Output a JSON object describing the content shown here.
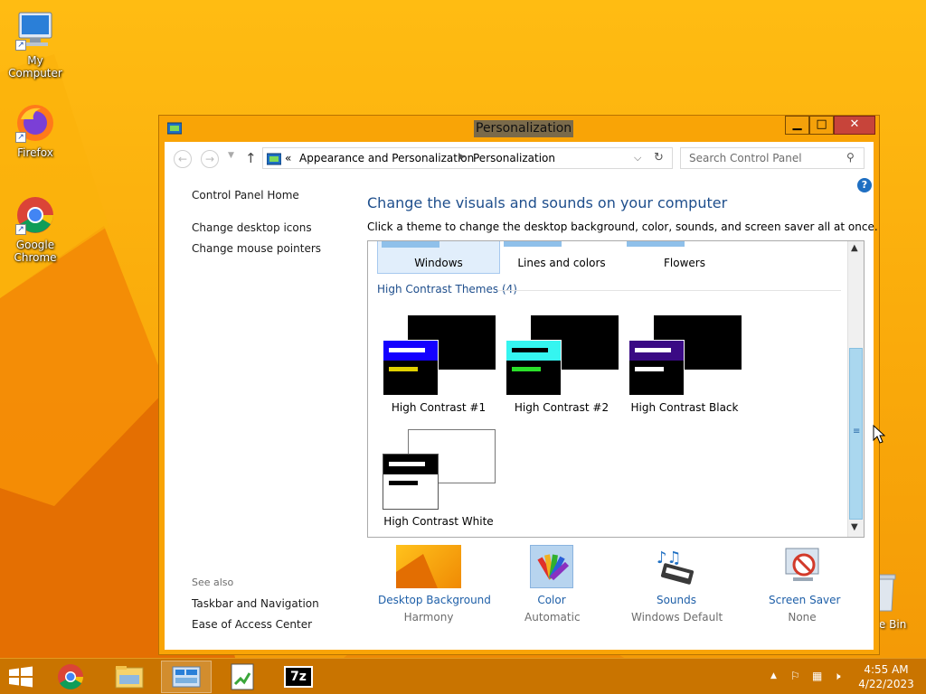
{
  "desktop": {
    "icons": [
      {
        "label": "My Computer",
        "name": "my-computer"
      },
      {
        "label": "Firefox",
        "name": "firefox"
      },
      {
        "label": "Google Chrome",
        "name": "google-chrome"
      }
    ],
    "recycle_bin_label": "cle Bin"
  },
  "window": {
    "title": "Personalization",
    "buttons": {
      "minimize": "▁",
      "maximize": "□",
      "close": "✕"
    }
  },
  "addressbar": {
    "path_prefix": "«",
    "path": [
      "Appearance and Personalization",
      "Personalization"
    ],
    "search_placeholder": "Search Control Panel"
  },
  "sidebar": {
    "links": [
      "Control Panel Home",
      "Change desktop icons",
      "Change mouse pointers"
    ],
    "see_also_title": "See also",
    "see_also_links": [
      "Taskbar and Navigation",
      "Ease of Access Center"
    ]
  },
  "main": {
    "heading": "Change the visuals and sounds on your computer",
    "description": "Click a theme to change the desktop background, color, sounds, and screen saver all at once."
  },
  "themes": {
    "top_row": [
      {
        "label": "Windows",
        "selected": true
      },
      {
        "label": "Lines and colors",
        "selected": false
      },
      {
        "label": "Flowers",
        "selected": false
      }
    ],
    "high_contrast_group_title": "High Contrast Themes (4)",
    "high_contrast": [
      {
        "label": "High Contrast #1",
        "header_color": "#1400ff",
        "accent_color": "#e0d000"
      },
      {
        "label": "High Contrast #2",
        "header_color": "#35f5f0",
        "accent_color": "#2ae02a"
      },
      {
        "label": "High Contrast Black",
        "header_color": "#3a0a84",
        "accent_color": "#ffffff"
      },
      {
        "label": "High Contrast White",
        "header_color": "#000000",
        "accent_color": "#000000"
      }
    ]
  },
  "bottom": {
    "items": [
      {
        "label": "Desktop Background",
        "sub": "Harmony"
      },
      {
        "label": "Color",
        "sub": "Automatic"
      },
      {
        "label": "Sounds",
        "sub": "Windows Default"
      },
      {
        "label": "Screen Saver",
        "sub": "None"
      }
    ]
  },
  "taskbar": {
    "time": "4:55 AM",
    "date": "4/22/2023",
    "apps": [
      "chrome",
      "file-explorer",
      "control-panel",
      "notepad-plus-plus",
      "7-zip"
    ],
    "seven_zip_label": "7z"
  },
  "colors": {
    "accent": "#f9a406",
    "link": "#1e5fa8",
    "heading": "#1e4e8c",
    "close": "#c7443a"
  }
}
